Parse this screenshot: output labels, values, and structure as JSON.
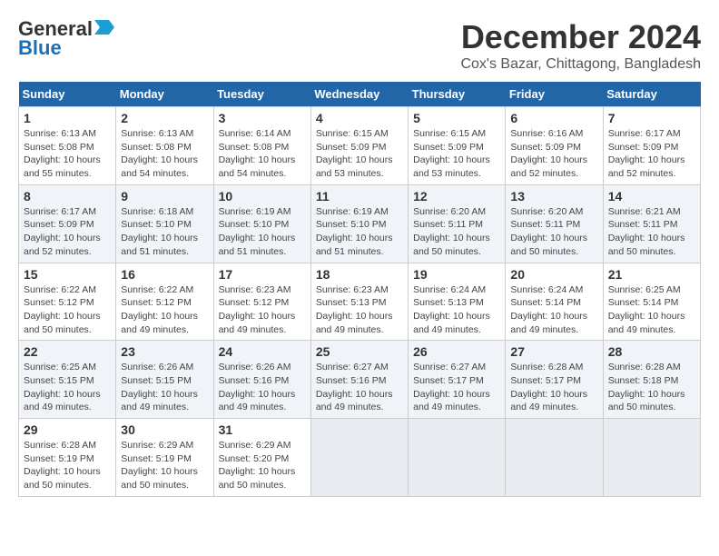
{
  "header": {
    "logo_line1": "General",
    "logo_line2": "Blue",
    "month_title": "December 2024",
    "location": "Cox's Bazar, Chittagong, Bangladesh"
  },
  "weekdays": [
    "Sunday",
    "Monday",
    "Tuesday",
    "Wednesday",
    "Thursday",
    "Friday",
    "Saturday"
  ],
  "days": [
    {
      "date": "",
      "empty": true
    },
    {
      "date": "",
      "empty": true
    },
    {
      "date": "",
      "empty": true
    },
    {
      "date": "",
      "empty": true
    },
    {
      "date": "",
      "empty": true
    },
    {
      "date": "",
      "empty": true
    },
    {
      "date": "7",
      "sunrise": "6:17 AM",
      "sunset": "5:09 PM",
      "daylight": "10 hours and 52 minutes."
    },
    {
      "date": "8",
      "sunrise": "6:17 AM",
      "sunset": "5:09 PM",
      "daylight": "10 hours and 52 minutes."
    },
    {
      "date": "9",
      "sunrise": "6:18 AM",
      "sunset": "5:10 PM",
      "daylight": "10 hours and 51 minutes."
    },
    {
      "date": "10",
      "sunrise": "6:19 AM",
      "sunset": "5:10 PM",
      "daylight": "10 hours and 51 minutes."
    },
    {
      "date": "11",
      "sunrise": "6:19 AM",
      "sunset": "5:10 PM",
      "daylight": "10 hours and 51 minutes."
    },
    {
      "date": "12",
      "sunrise": "6:20 AM",
      "sunset": "5:11 PM",
      "daylight": "10 hours and 50 minutes."
    },
    {
      "date": "13",
      "sunrise": "6:20 AM",
      "sunset": "5:11 PM",
      "daylight": "10 hours and 50 minutes."
    },
    {
      "date": "14",
      "sunrise": "6:21 AM",
      "sunset": "5:11 PM",
      "daylight": "10 hours and 50 minutes."
    },
    {
      "date": "15",
      "sunrise": "6:22 AM",
      "sunset": "5:12 PM",
      "daylight": "10 hours and 50 minutes."
    },
    {
      "date": "16",
      "sunrise": "6:22 AM",
      "sunset": "5:12 PM",
      "daylight": "10 hours and 49 minutes."
    },
    {
      "date": "17",
      "sunrise": "6:23 AM",
      "sunset": "5:12 PM",
      "daylight": "10 hours and 49 minutes."
    },
    {
      "date": "18",
      "sunrise": "6:23 AM",
      "sunset": "5:13 PM",
      "daylight": "10 hours and 49 minutes."
    },
    {
      "date": "19",
      "sunrise": "6:24 AM",
      "sunset": "5:13 PM",
      "daylight": "10 hours and 49 minutes."
    },
    {
      "date": "20",
      "sunrise": "6:24 AM",
      "sunset": "5:14 PM",
      "daylight": "10 hours and 49 minutes."
    },
    {
      "date": "21",
      "sunrise": "6:25 AM",
      "sunset": "5:14 PM",
      "daylight": "10 hours and 49 minutes."
    },
    {
      "date": "22",
      "sunrise": "6:25 AM",
      "sunset": "5:15 PM",
      "daylight": "10 hours and 49 minutes."
    },
    {
      "date": "23",
      "sunrise": "6:26 AM",
      "sunset": "5:15 PM",
      "daylight": "10 hours and 49 minutes."
    },
    {
      "date": "24",
      "sunrise": "6:26 AM",
      "sunset": "5:16 PM",
      "daylight": "10 hours and 49 minutes."
    },
    {
      "date": "25",
      "sunrise": "6:27 AM",
      "sunset": "5:16 PM",
      "daylight": "10 hours and 49 minutes."
    },
    {
      "date": "26",
      "sunrise": "6:27 AM",
      "sunset": "5:17 PM",
      "daylight": "10 hours and 49 minutes."
    },
    {
      "date": "27",
      "sunrise": "6:28 AM",
      "sunset": "5:17 PM",
      "daylight": "10 hours and 49 minutes."
    },
    {
      "date": "28",
      "sunrise": "6:28 AM",
      "sunset": "5:18 PM",
      "daylight": "10 hours and 50 minutes."
    },
    {
      "date": "29",
      "sunrise": "6:28 AM",
      "sunset": "5:19 PM",
      "daylight": "10 hours and 50 minutes."
    },
    {
      "date": "30",
      "sunrise": "6:29 AM",
      "sunset": "5:19 PM",
      "daylight": "10 hours and 50 minutes."
    },
    {
      "date": "31",
      "sunrise": "6:29 AM",
      "sunset": "5:20 PM",
      "daylight": "10 hours and 50 minutes."
    }
  ],
  "week1": [
    {
      "date": "1",
      "sunrise": "6:13 AM",
      "sunset": "5:08 PM",
      "daylight": "10 hours and 55 minutes."
    },
    {
      "date": "2",
      "sunrise": "6:13 AM",
      "sunset": "5:08 PM",
      "daylight": "10 hours and 54 minutes."
    },
    {
      "date": "3",
      "sunrise": "6:14 AM",
      "sunset": "5:08 PM",
      "daylight": "10 hours and 54 minutes."
    },
    {
      "date": "4",
      "sunrise": "6:15 AM",
      "sunset": "5:09 PM",
      "daylight": "10 hours and 53 minutes."
    },
    {
      "date": "5",
      "sunrise": "6:15 AM",
      "sunset": "5:09 PM",
      "daylight": "10 hours and 53 minutes."
    },
    {
      "date": "6",
      "sunrise": "6:16 AM",
      "sunset": "5:09 PM",
      "daylight": "10 hours and 52 minutes."
    },
    {
      "date": "7",
      "sunrise": "6:17 AM",
      "sunset": "5:09 PM",
      "daylight": "10 hours and 52 minutes."
    }
  ]
}
